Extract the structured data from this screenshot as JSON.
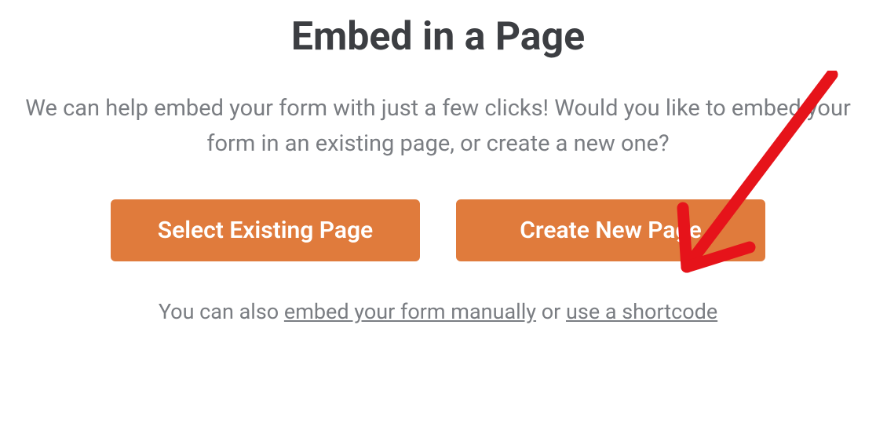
{
  "title": "Embed in a Page",
  "description": "We can help embed your form with just a few clicks! Would you like to embed your form in an existing page, or create a new one?",
  "buttons": {
    "select_existing": "Select Existing Page",
    "create_new": "Create New Page"
  },
  "footer": {
    "prefix": "You can also ",
    "link_manual": "embed your form manually",
    "middle": " or ",
    "link_shortcode": "use a shortcode"
  },
  "annotation": {
    "arrow_color": "#e6131a"
  }
}
